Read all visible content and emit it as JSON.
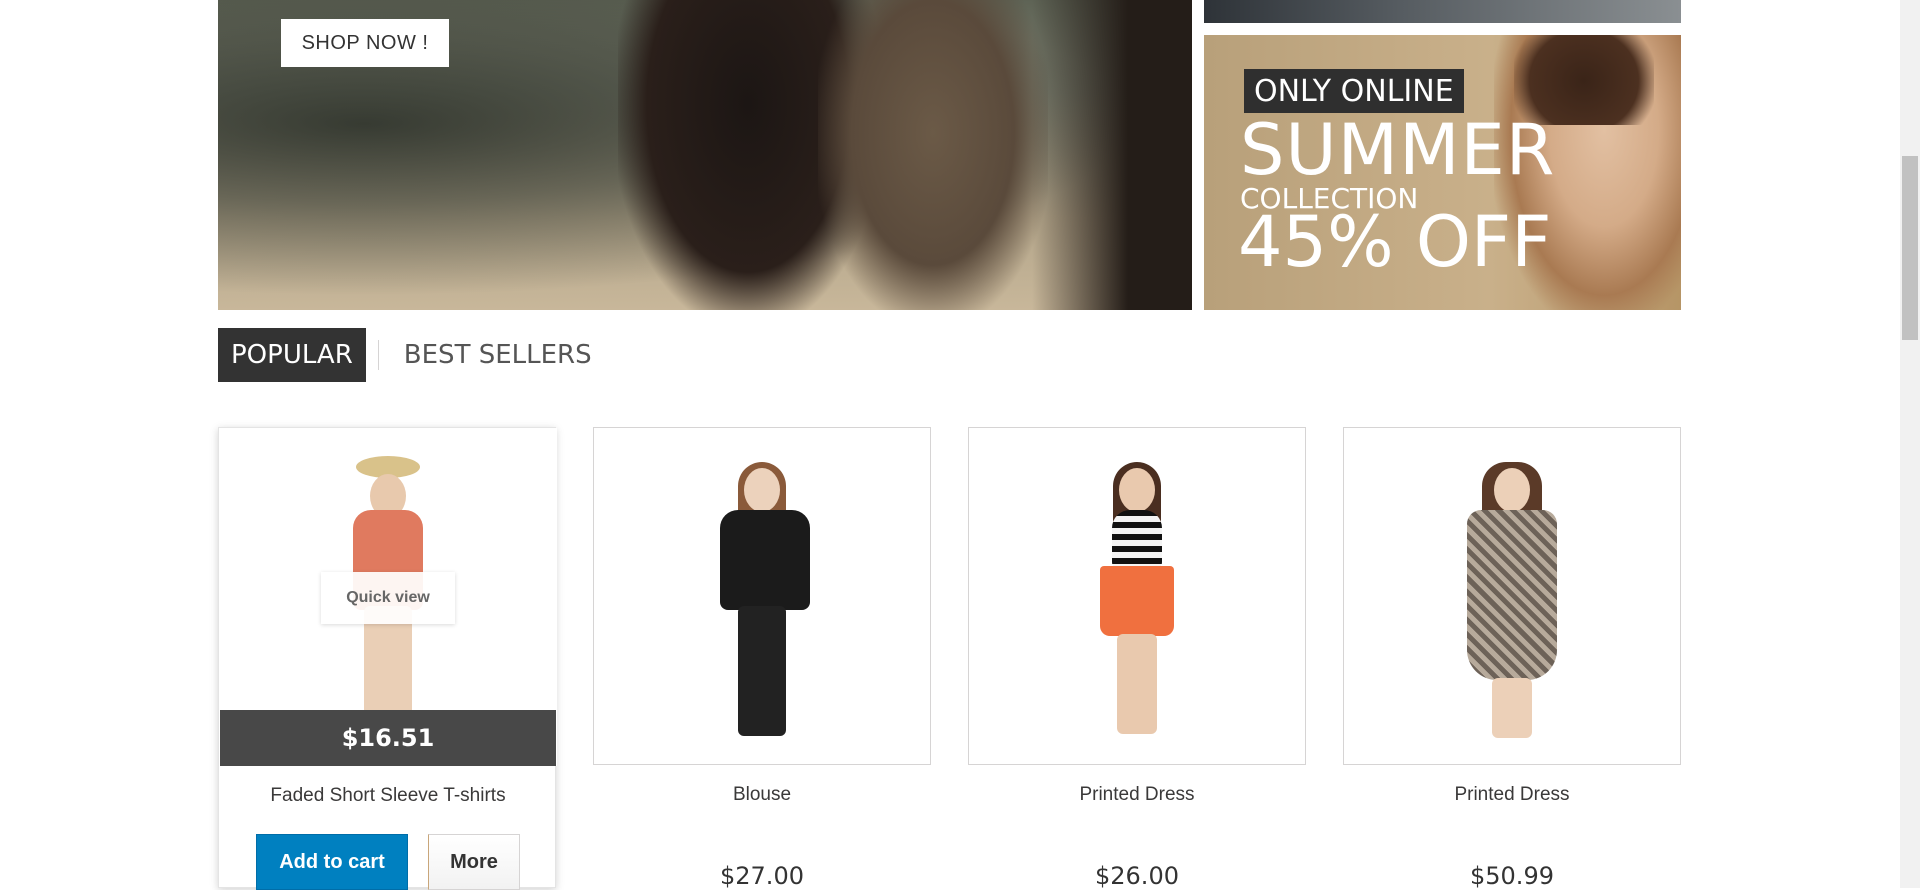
{
  "hero": {
    "shop_now_label": "SHOP NOW !",
    "prev_icon": "chevron-left-icon",
    "next_icon": "chevron-right-icon"
  },
  "banner": {
    "only_online": "ONLY ONLINE",
    "summer": "SUMMER",
    "collection": "COLLECTION",
    "off": "45% OFF"
  },
  "tabs": [
    {
      "label": "POPULAR",
      "active": true
    },
    {
      "label": "BEST SELLERS",
      "active": false
    }
  ],
  "products": [
    {
      "name": "Faded Short Sleeve T-shirts",
      "price": "$16.51",
      "quick_view": "Quick view",
      "add_to_cart": "Add to cart",
      "more": "More"
    },
    {
      "name": "Blouse",
      "price": "$27.00"
    },
    {
      "name": "Printed Dress",
      "price": "$26.00"
    },
    {
      "name": "Printed Dress",
      "price": "$50.99"
    }
  ],
  "colors": {
    "add_to_cart": "#0080c0",
    "price_bar": "#484848",
    "active_tab": "#333333"
  }
}
